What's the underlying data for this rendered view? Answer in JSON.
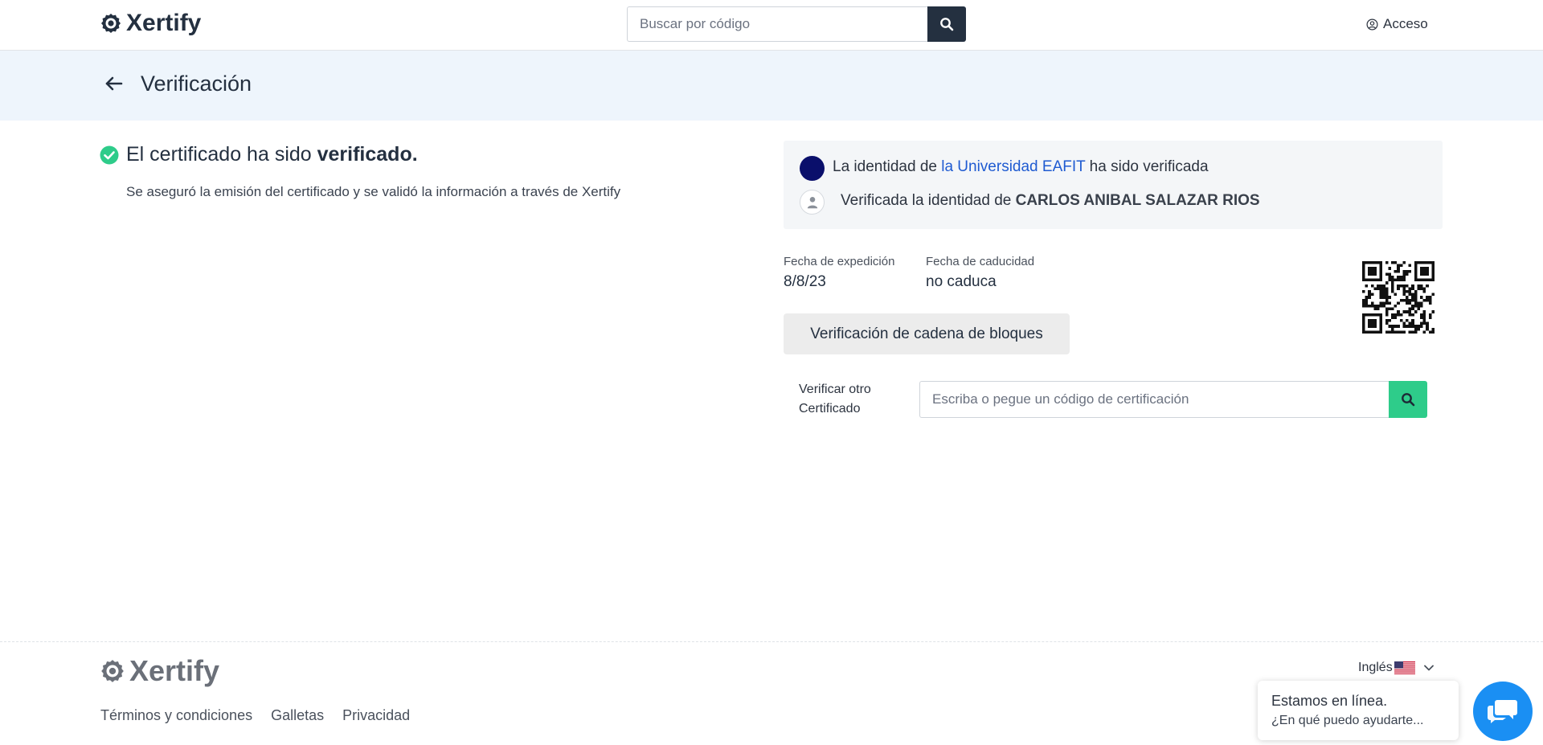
{
  "header": {
    "brand": "Xertify",
    "search_placeholder": "Buscar por código",
    "access_label": "Acceso",
    "icons": {
      "logo": "badge-check-icon",
      "search": "search-icon",
      "access": "user-circle-icon"
    }
  },
  "page": {
    "title": "Verificación",
    "back_icon": "arrow-left-icon"
  },
  "status": {
    "title_prefix": "El certificado ha sido ",
    "title_bold": "verificado.",
    "description": "Se aseguró la emisión del certificado y se validó la información a través de Xertify"
  },
  "identity": {
    "institution_prefix": "La identidad de ",
    "institution_link": "la Universidad EAFIT",
    "institution_suffix": " ha sido verificada",
    "person_prefix": "Verificada la identidad de ",
    "person_name": "CARLOS ANIBAL SALAZAR RIOS"
  },
  "dates": {
    "issue_label": "Fecha de expedición",
    "issue_value": "8/8/23",
    "expiry_label": "Fecha de caducidad",
    "expiry_value": "no caduca"
  },
  "blockchain_button": "Verificación de cadena de bloques",
  "verify_other": {
    "label_line1": "Verificar otro",
    "label_line2": "Certificado",
    "placeholder": "Escriba o pegue un código de certificación"
  },
  "footer": {
    "brand": "Xertify",
    "links": [
      "Términos y condiciones",
      "Galletas",
      "Privacidad"
    ],
    "language": "Inglés"
  },
  "chat": {
    "line1": "Estamos en línea.",
    "line2": "¿En qué puedo ayudarte..."
  },
  "colors": {
    "navy": "#243040",
    "green": "#2ecc8a",
    "chat_blue": "#1a8ff3",
    "link_blue": "#1f5bd1",
    "band": "#eef5fc"
  }
}
